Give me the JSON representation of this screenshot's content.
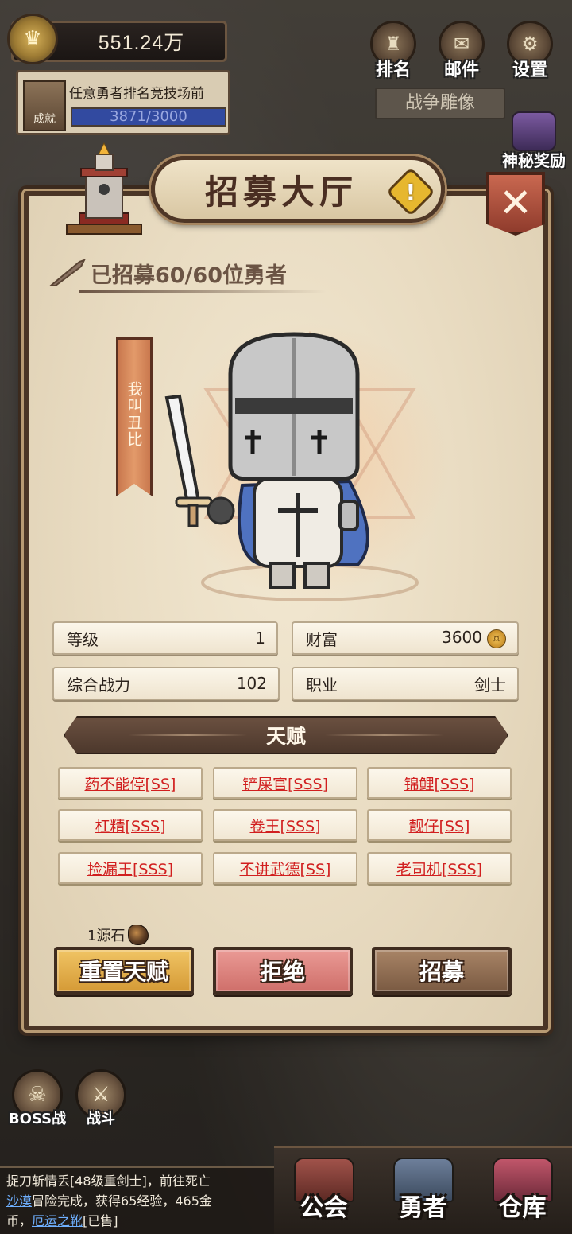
{
  "hud": {
    "gold_amount": "551.24万",
    "quest": {
      "text": "任意勇者排名竞技场前",
      "badge": "成就",
      "progress_text": "3871/3000",
      "progress_fraction": 1.0
    },
    "top_buttons": [
      {
        "label": "排名"
      },
      {
        "label": "邮件"
      },
      {
        "label": "设置"
      }
    ],
    "war_statue": "战争雕像",
    "mystery_reward": "神秘奖励"
  },
  "panel": {
    "title": "招募大厅",
    "info_icon": "!",
    "close_icon": "✕",
    "recruited_text": "已招募60/60位勇者",
    "hero": {
      "name": "我叫丑比",
      "class_icon": "knight-icon"
    },
    "stats": {
      "level_label": "等级",
      "level_value": "1",
      "wealth_label": "财富",
      "wealth_value": "3600",
      "power_label": "综合战力",
      "power_value": "102",
      "job_label": "职业",
      "job_value": "剑士"
    },
    "talent_header": "天赋",
    "talents": [
      "药不能停[SS]",
      "铲屎官[SSS]",
      "锦鲤[SSS]",
      "杠精[SSS]",
      "卷王[SSS]",
      "靓仔[SS]",
      "捡漏王[SSS]",
      "不讲武德[SS]",
      "老司机[SSS]"
    ],
    "cost_text": "1源石",
    "buttons": {
      "reset": "重置天赋",
      "reject": "拒绝",
      "recruit": "招募"
    }
  },
  "bottom": {
    "left_buttons": [
      {
        "label": "BOSS战"
      },
      {
        "label": "战斗"
      }
    ],
    "log": {
      "line1": "捉刀斩情丢[48级重剑士]，前往死亡",
      "place": "沙漠",
      "line2": "冒险完成，获得65经验，465金",
      "line3_prefix": "币，",
      "item": "厄运之靴",
      "line3_suffix": "[已售]"
    },
    "nav": [
      {
        "label": "公会"
      },
      {
        "label": "勇者"
      },
      {
        "label": "仓库"
      }
    ]
  },
  "colors": {
    "talent_red": "#d11f1f",
    "panel_border": "#4a3526",
    "parchment": "#ecdfc6"
  }
}
